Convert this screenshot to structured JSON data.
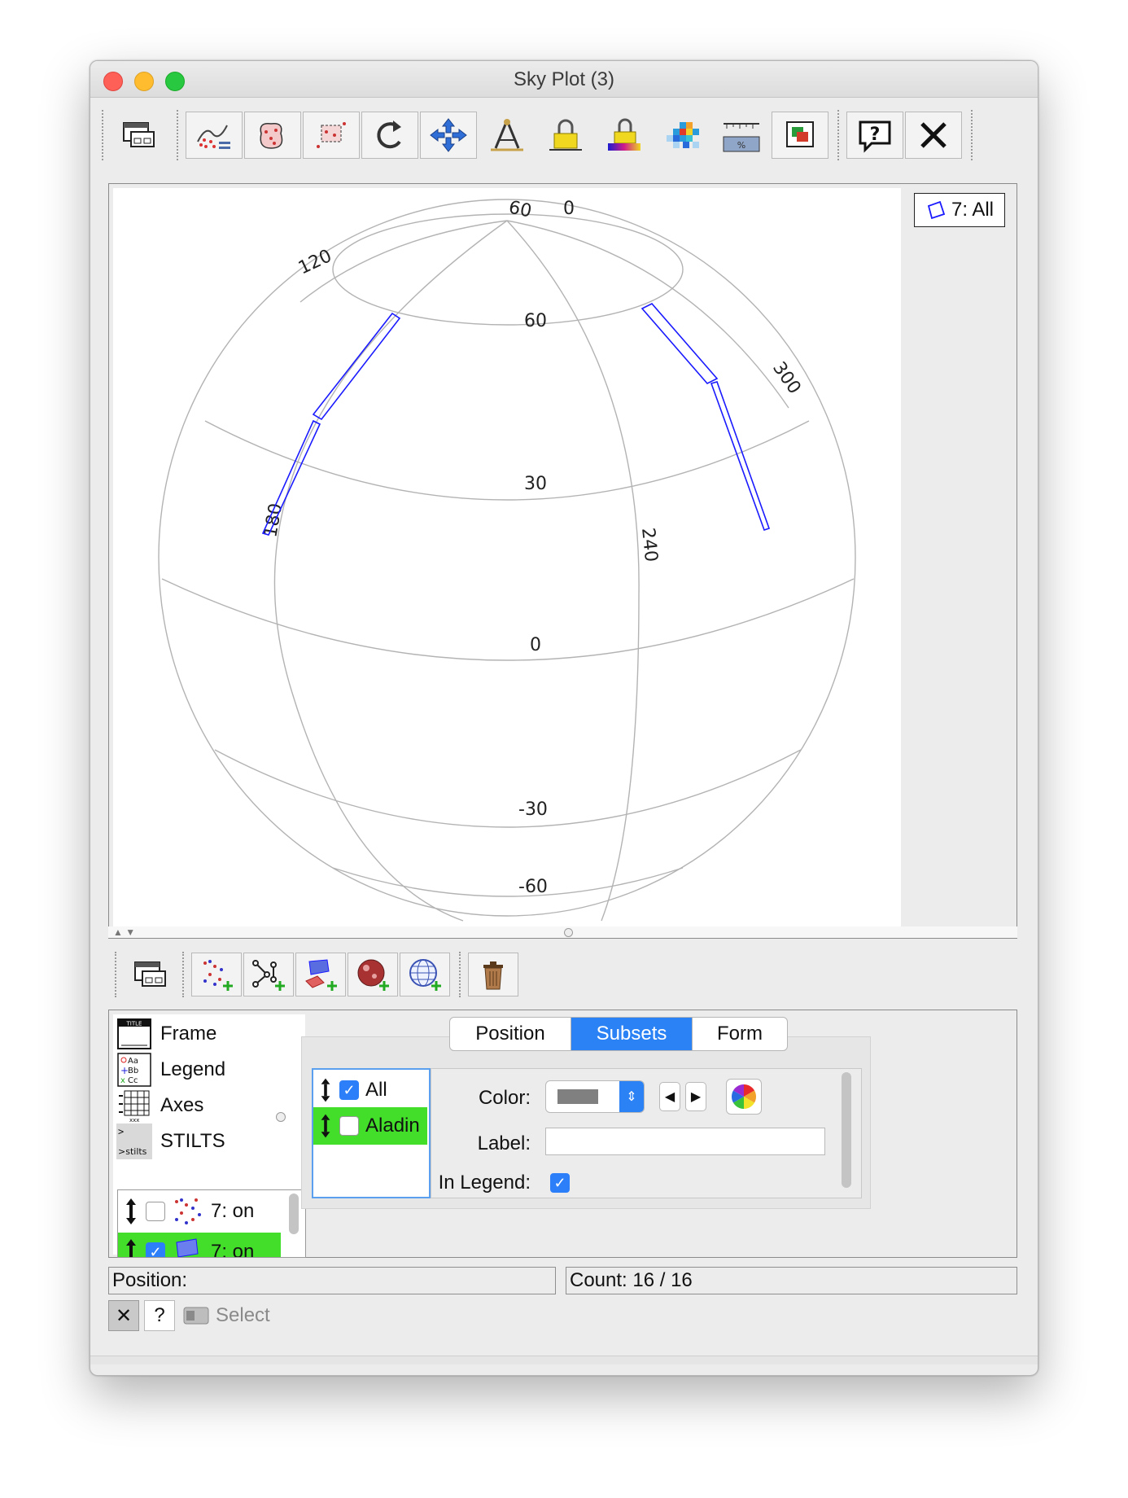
{
  "window": {
    "title": "Sky Plot (3)"
  },
  "toolbar": {
    "icons": [
      "window-icon",
      "fit-plot-icon",
      "blob-select-icon",
      "zoom-box-icon",
      "reorient-icon",
      "navigate-icon",
      "axis-gauge-icon",
      "aux-lock-icon",
      "aux-lock-color-icon",
      "density-icon",
      "subset-range-icon",
      "export-icon",
      "help-icon",
      "close-icon"
    ]
  },
  "plot": {
    "legend_label": "7: All",
    "lat_labels": [
      "60",
      "30",
      "0",
      "-30",
      "-60"
    ],
    "lon_labels": [
      "60",
      "0",
      "120",
      "300",
      "180",
      "240"
    ]
  },
  "layer_toolbar": {
    "icons": [
      "window-icon",
      "add-position-layer-icon",
      "add-pair-layer-icon",
      "add-area-layer-icon",
      "add-hips-layer-icon",
      "add-sky-grid-layer-icon",
      "delete-layer-icon"
    ]
  },
  "controls": {
    "items": [
      {
        "label": "Frame"
      },
      {
        "label": "Legend"
      },
      {
        "label": "Axes"
      },
      {
        "label": "STILTS"
      }
    ],
    "layers": [
      {
        "label": "7: on",
        "checked": false
      },
      {
        "label": "7: on",
        "checked": true
      }
    ],
    "tabs": [
      "Position",
      "Subsets",
      "Form"
    ],
    "active_tab": "Subsets",
    "subsets": [
      {
        "label": "All",
        "checked": true
      },
      {
        "label": "Aladin",
        "checked": false
      }
    ],
    "form": {
      "color_label": "Color:",
      "color_value": "#808080",
      "label_label": "Label:",
      "label_value": "",
      "in_legend_label": "In Legend:",
      "in_legend_checked": true
    }
  },
  "status": {
    "position": "Position:",
    "count": "Count: 16 / 16"
  },
  "bottom": {
    "close_glyph": "✕",
    "help_glyph": "?",
    "select_label": "Select"
  },
  "colors": {
    "accent": "#2a82f4",
    "highlight": "#43de2a",
    "shape": "#1a1aff"
  }
}
